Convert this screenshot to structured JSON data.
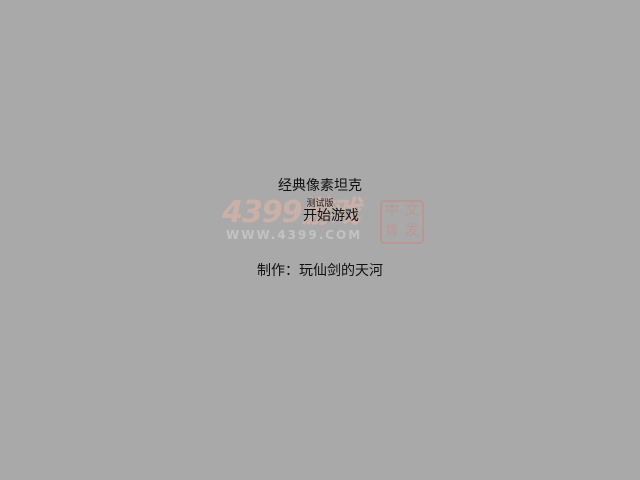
{
  "screen": {
    "background_color": "#a9a9a9"
  },
  "title": "经典像素坦克",
  "subtitle": "测试版",
  "start_button_label": "开始游戏",
  "credits": "制作：玩仙剑的天河",
  "watermark": {
    "logo_text": "4399游戏",
    "url_text": "WWW.4399.COM",
    "seal_chars": [
      "中",
      "文",
      "肯",
      "发"
    ]
  }
}
